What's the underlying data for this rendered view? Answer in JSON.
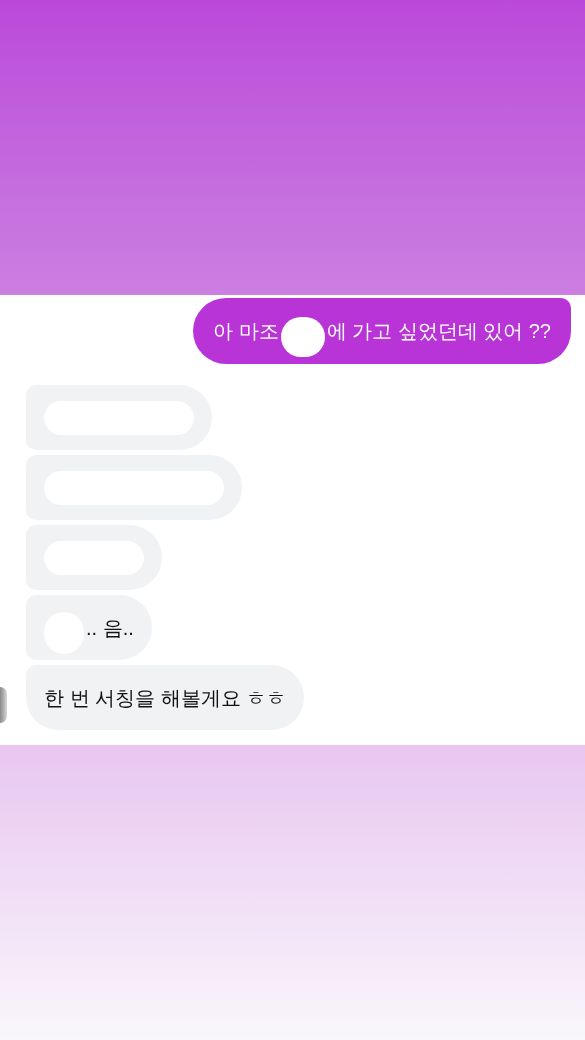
{
  "sent": [
    {
      "parts": [
        {
          "kind": "text",
          "text": "아 마조"
        },
        {
          "kind": "redacted"
        },
        {
          "kind": "text",
          "text": "에 가고 싶었던데 있어 ??"
        }
      ]
    }
  ],
  "received": [
    {
      "avatar": false,
      "parts": [
        {
          "kind": "redacted"
        }
      ]
    },
    {
      "avatar": false,
      "parts": [
        {
          "kind": "redacted"
        }
      ]
    },
    {
      "avatar": false,
      "parts": [
        {
          "kind": "redacted"
        }
      ]
    },
    {
      "avatar": false,
      "parts": [
        {
          "kind": "redacted"
        },
        {
          "kind": "text",
          "text": ".. 음.."
        }
      ]
    },
    {
      "avatar": true,
      "parts": [
        {
          "kind": "text",
          "text": "한 번 서칭을 해볼게요 ㅎㅎ"
        }
      ]
    }
  ]
}
